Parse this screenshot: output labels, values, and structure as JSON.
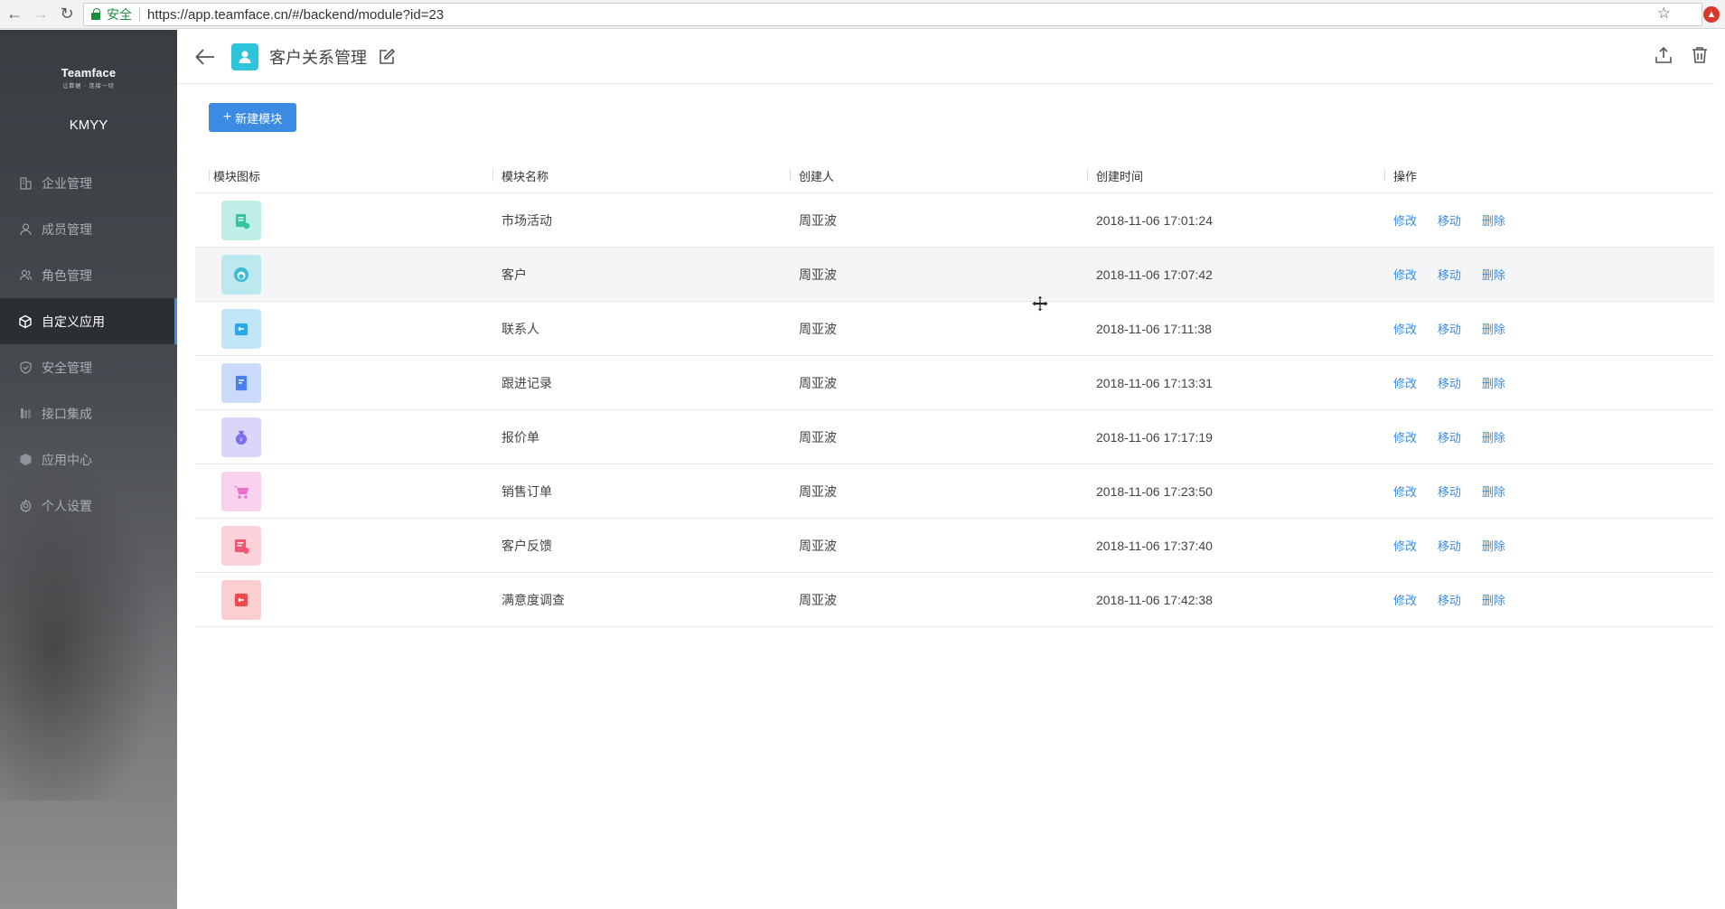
{
  "browser": {
    "secure_label": "安全",
    "url": "https://app.teamface.cn/#/backend/module?id=23"
  },
  "sidebar": {
    "logo_name": "Teamface",
    "logo_slogan": "让数据 · 连接一切",
    "company": "KMYY",
    "items": [
      {
        "label": "企业管理",
        "icon": "building-icon"
      },
      {
        "label": "成员管理",
        "icon": "user-icon"
      },
      {
        "label": "角色管理",
        "icon": "role-icon"
      },
      {
        "label": "自定义应用",
        "icon": "cube-icon",
        "active": true
      },
      {
        "label": "安全管理",
        "icon": "shield-icon"
      },
      {
        "label": "接口集成",
        "icon": "plug-icon"
      },
      {
        "label": "应用中心",
        "icon": "box-icon"
      },
      {
        "label": "个人设置",
        "icon": "gear-icon"
      }
    ]
  },
  "header": {
    "title": "客户关系管理"
  },
  "toolbar": {
    "new_module_label": "新建模块"
  },
  "table": {
    "columns": [
      "模块图标",
      "模块名称",
      "创建人",
      "创建时间",
      "操作"
    ],
    "actions": [
      "修改",
      "移动",
      "删除"
    ],
    "rows": [
      {
        "name": "市场活动",
        "creator": "周亚波",
        "time": "2018-11-06 17:01:24",
        "icon_bg": "#bfeee6",
        "icon_fg": "#34c4a3",
        "icon": "campaign-icon"
      },
      {
        "name": "客户",
        "creator": "周亚波",
        "time": "2018-11-06 17:07:42",
        "icon_bg": "#bde8ef",
        "icon_fg": "#3fbcd4",
        "icon": "customer-icon"
      },
      {
        "name": "联系人",
        "creator": "周亚波",
        "time": "2018-11-06 17:11:38",
        "icon_bg": "#c2e6f7",
        "icon_fg": "#29a9e6",
        "icon": "contact-icon"
      },
      {
        "name": "跟进记录",
        "creator": "周亚波",
        "time": "2018-11-06 17:13:31",
        "icon_bg": "#cadafb",
        "icon_fg": "#4a7ff0",
        "icon": "record-icon"
      },
      {
        "name": "报价单",
        "creator": "周亚波",
        "time": "2018-11-06 17:17:19",
        "icon_bg": "#d9d6fa",
        "icon_fg": "#7c6cf0",
        "icon": "money-bag-icon"
      },
      {
        "name": "销售订单",
        "creator": "周亚波",
        "time": "2018-11-06 17:23:50",
        "icon_bg": "#f9d3ee",
        "icon_fg": "#ea6fc8",
        "icon": "cart-icon"
      },
      {
        "name": "客户反馈",
        "creator": "周亚波",
        "time": "2018-11-06 17:37:40",
        "icon_bg": "#fbd2da",
        "icon_fg": "#f0566f",
        "icon": "feedback-icon"
      },
      {
        "name": "满意度调查",
        "creator": "周亚波",
        "time": "2018-11-06 17:42:38",
        "icon_bg": "#fbcfcf",
        "icon_fg": "#ef4a4a",
        "icon": "survey-icon"
      }
    ]
  },
  "colors": {
    "accent": "#3b8be3",
    "module_icon": "#2ec4d9"
  }
}
